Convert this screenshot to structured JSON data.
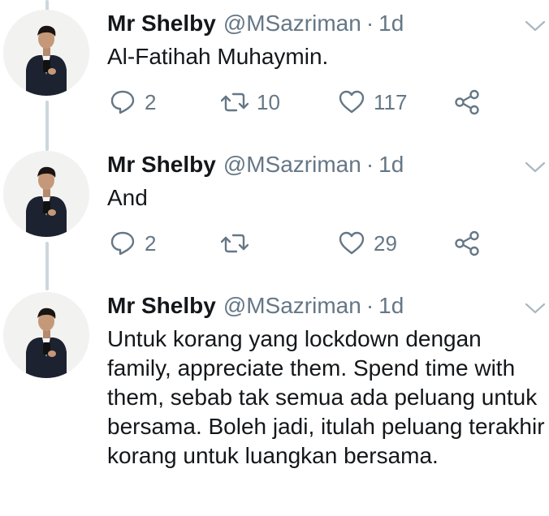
{
  "tweets": [
    {
      "name": "Mr Shelby",
      "handle": "@MSazriman",
      "separator": "·",
      "time": "1d",
      "text": "Al-Fatihah Muhaymin.",
      "reply_count": "2",
      "retweet_count": "10",
      "like_count": "117"
    },
    {
      "name": "Mr Shelby",
      "handle": "@MSazriman",
      "separator": "·",
      "time": "1d",
      "text": "And",
      "reply_count": "2",
      "retweet_count": "",
      "like_count": "29"
    },
    {
      "name": "Mr Shelby",
      "handle": "@MSazriman",
      "separator": "·",
      "time": "1d",
      "text": "Untuk korang yang lockdown dengan family, appreciate them. Spend time with them, sebab tak semua ada peluang untuk bersama. Boleh jadi, itulah peluang terakhir korang untuk luangkan bersama."
    }
  ],
  "icons": {
    "reply": "reply-icon",
    "retweet": "retweet-icon",
    "like": "heart-icon",
    "share": "share-icon",
    "caret": "chevron-down-icon",
    "avatar": "avatar-photo"
  },
  "colors": {
    "text": "#14171a",
    "secondary": "#657786",
    "thread_line": "#ccd6dd"
  }
}
